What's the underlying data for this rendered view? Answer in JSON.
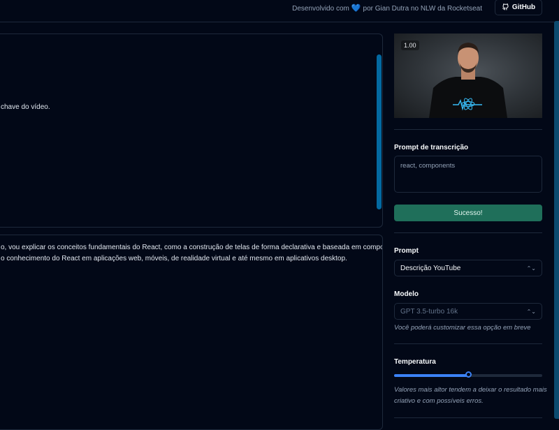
{
  "header": {
    "credit_prefix": "Desenvolvido com",
    "credit_suffix": "por Gian Dutra no NLW da Rocketseat",
    "github_label": "GitHub"
  },
  "editor": {
    "prompt_fragment": "chave do vídeo.",
    "result_lines": [
      "o, vou explicar os conceitos fundamentais do React, como a construção de telas de forma declarativa e baseada em componentes.",
      "o conhecimento do React em aplicações web, móveis, de realidade virtual e até mesmo em aplicativos desktop."
    ]
  },
  "video": {
    "speed": "1.00"
  },
  "sidebar": {
    "transcription_label": "Prompt de transcrição",
    "transcription_placeholder": "react, components",
    "upload_status": "Sucesso!",
    "prompt_label": "Prompt",
    "prompt_selected": "Descrição YouTube",
    "model_label": "Modelo",
    "model_selected": "GPT 3.5-turbo 16k",
    "model_help": "Você poderá customizar essa opção em breve",
    "temperature_label": "Temperatura",
    "temperature_value": 0.5,
    "temperature_help_1": "Valores mais altor tendem a deixar o resultado mais",
    "temperature_help_2": "criativo e com possíveis erros."
  },
  "colors": {
    "accent": "#3b82f6",
    "success": "#1f6f5a",
    "background": "#020817"
  }
}
